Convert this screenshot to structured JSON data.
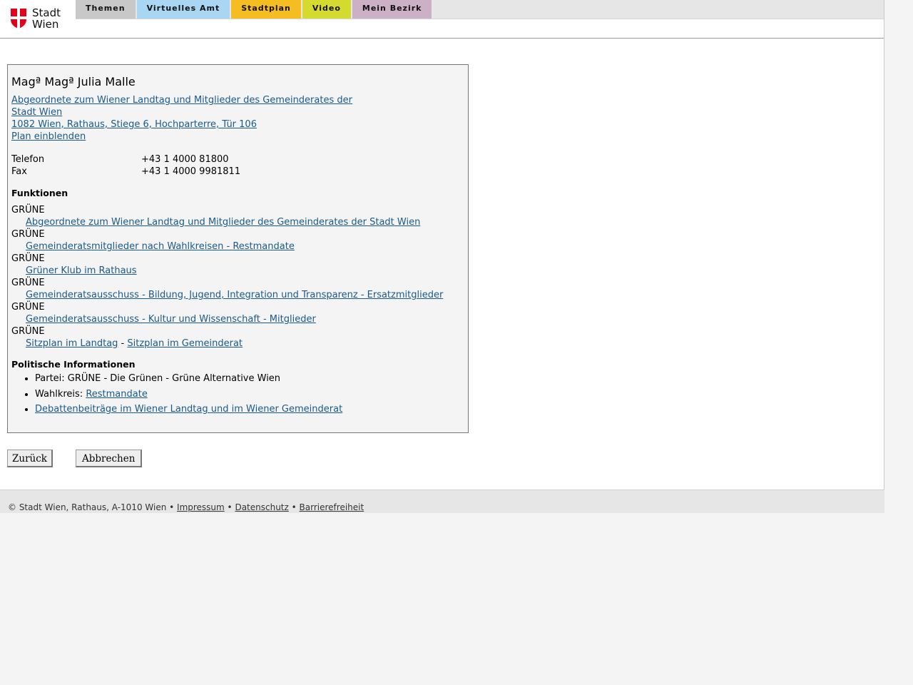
{
  "header": {
    "logo": {
      "line1": "Stadt",
      "line2": "Wien"
    },
    "nav": [
      {
        "label": "Themen",
        "color": "#c8c8c8"
      },
      {
        "label": "Virtuelles Amt",
        "color": "#a9d6f2"
      },
      {
        "label": "Stadtplan",
        "color": "#f5bd1f"
      },
      {
        "label": "Video",
        "color": "#d4da2e"
      },
      {
        "label": "Mein Bezirk",
        "color": "#cbb0c6"
      }
    ]
  },
  "person": {
    "name": "Magª Magª Julia Malle",
    "org_line1": "Abgeordnete zum Wiener Landtag und Mitglieder des Gemeinderates der",
    "org_line2": "Stadt Wien ",
    "address": "1082 Wien, Rathaus, Stiege 6, Hochparterre, Tür 106",
    "plan_link": "Plan einblenden"
  },
  "contact": {
    "phone_label": "Telefon",
    "phone_value": "+43 1 4000 81800",
    "fax_label": "Fax",
    "fax_value": "+43 1 4000 9981811"
  },
  "functions": {
    "title": "Funktionen",
    "items": [
      {
        "party": "GRÜNE",
        "link": "Abgeordnete zum Wiener Landtag und Mitglieder des Gemeinderates der Stadt Wien"
      },
      {
        "party": "GRÜNE",
        "link": "Gemeinderatsmitglieder nach Wahlkreisen - Restmandate"
      },
      {
        "party": "GRÜNE",
        "link": "Grüner Klub im Rathaus"
      },
      {
        "party": "GRÜNE",
        "link": "Gemeinderatsausschuss - Bildung, Jugend, Integration und Transparenz - Ersatzmitglieder"
      },
      {
        "party": "GRÜNE",
        "link": "Gemeinderatsausschuss - Kultur und Wissenschaft - Mitglieder"
      }
    ],
    "last_party": "GRÜNE",
    "seat_plan_landtag": "Sitzplan im Landtag",
    "separator": " - ",
    "seat_plan_gemeinderat": "Sitzplan im Gemeinderat"
  },
  "political": {
    "title": "Politische Informationen",
    "party": "Partei: GRÜNE - Die Grünen - Grüne Alternative Wien",
    "district_label": "Wahlkreis: ",
    "district_link": "Restmandate",
    "debates_link": "Debattenbeiträge im Wiener Landtag und im Wiener Gemeinderat"
  },
  "buttons": {
    "back": "Zurück",
    "cancel": "Abbrechen"
  },
  "footer": {
    "copyright": "© Stadt Wien, Rathaus, A-1010 Wien",
    "bullet": " • ",
    "impressum": "Impressum",
    "datenschutz": "Datenschutz",
    "barrierefreiheit": "Barrierefreiheit"
  }
}
